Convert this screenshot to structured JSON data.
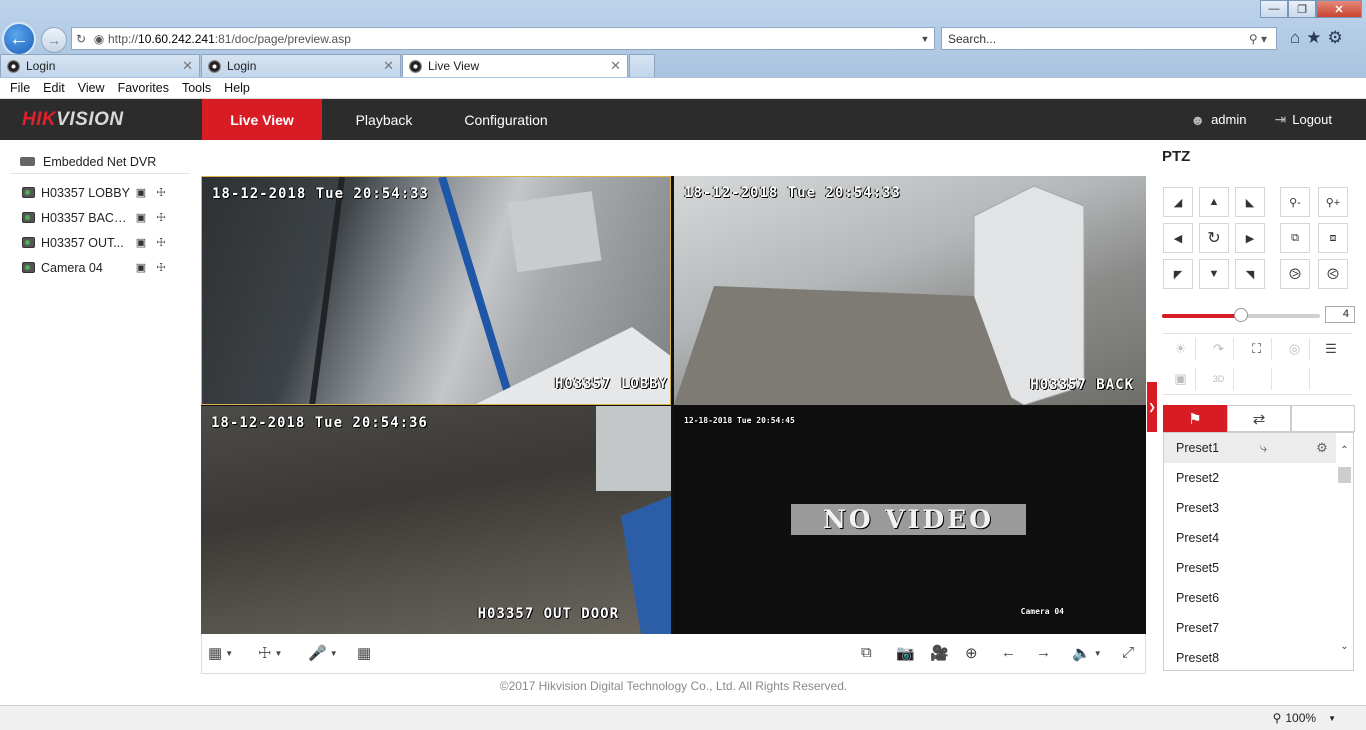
{
  "browser": {
    "url_prefix": "http://",
    "url_host": "10.60.242.241",
    "url_path": ":81/doc/page/preview.asp",
    "search_placeholder": "Search...",
    "tabs": [
      {
        "label": "Login"
      },
      {
        "label": "Login"
      },
      {
        "label": "Live View"
      }
    ],
    "menu": [
      "File",
      "Edit",
      "View",
      "Favorites",
      "Tools",
      "Help"
    ],
    "zoom": "100%"
  },
  "header": {
    "logo_red": "HIK",
    "logo_gray": "VISION",
    "nav": [
      "Live View",
      "Playback",
      "Configuration"
    ],
    "active_nav": "Live View",
    "user": "admin",
    "logout": "Logout"
  },
  "tree": {
    "root": "Embedded Net DVR",
    "cameras": [
      {
        "name": "H03357 LOBBY"
      },
      {
        "name": "H03357 BACK..."
      },
      {
        "name": "H03357 OUT..."
      },
      {
        "name": "Camera 04"
      }
    ]
  },
  "video": {
    "cells": [
      {
        "timestamp": "18-12-2018 Tue 20:54:33",
        "label": "H03357 LOBBY"
      },
      {
        "timestamp": "18-12-2018 Tue 20:54:33",
        "label": "H03357 BACK"
      },
      {
        "timestamp": "18-12-2018 Tue 20:54:36",
        "label": "H03357 OUT DOOR"
      },
      {
        "timestamp": "12-18-2018 Tue 20:54:45",
        "label": "Camera 04",
        "no_video": "NO VIDEO"
      }
    ]
  },
  "footer": {
    "copyright": "©2017 Hikvision Digital Technology Co., Ltd. All Rights Reserved."
  },
  "ptz": {
    "title": "PTZ",
    "speed": "4",
    "speed_level": 0.5,
    "presets": [
      "Preset1",
      "Preset2",
      "Preset3",
      "Preset4",
      "Preset5",
      "Preset6",
      "Preset7",
      "Preset8"
    ]
  },
  "colors": {
    "accent": "#d81c24",
    "header_bg": "#2c2c2c"
  }
}
